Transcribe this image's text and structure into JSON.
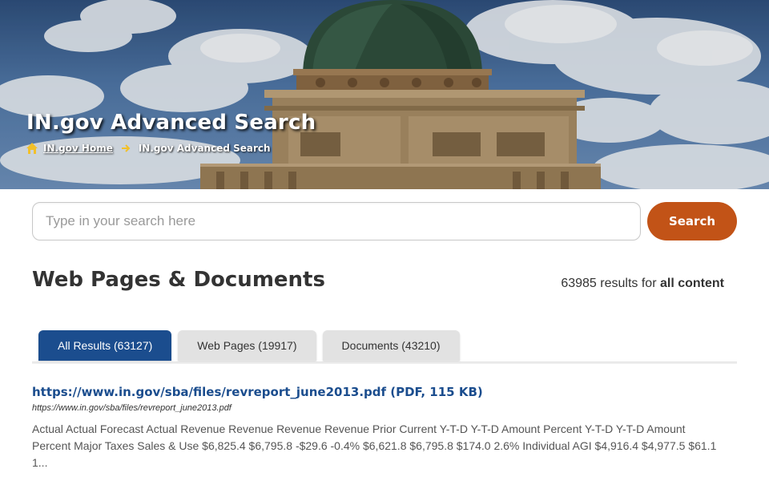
{
  "hero": {
    "title": "IN.gov Advanced Search",
    "breadcrumb": {
      "home_icon": "home-icon",
      "home_label": "IN.gov Home",
      "separator_icon": "arrow-right-icon",
      "current_label": "IN.gov Advanced Search"
    }
  },
  "search": {
    "placeholder": "Type in your search here",
    "value": "",
    "button_label": "Search"
  },
  "results_header": {
    "heading": "Web Pages & Documents",
    "count": "63985",
    "count_text": "results for",
    "scope": "all content"
  },
  "tabs": [
    {
      "label": "All Results (63127)",
      "active": true
    },
    {
      "label": "Web Pages (19917)",
      "active": false
    },
    {
      "label": "Documents (43210)",
      "active": false
    }
  ],
  "results": [
    {
      "title": "https://www.in.gov/sba/files/revreport_june2013.pdf (PDF, 115 KB)",
      "url": "https://www.in.gov/sba/files/revreport_june2013.pdf",
      "snippet": "Actual Actual Forecast Actual Revenue Revenue Revenue Revenue Prior Current Y-T-D Y-T-D Amount Percent Y-T-D Y-T-D Amount Percent Major Taxes Sales & Use $6,825.4 $6,795.8 -$29.6 -0.4% $6,621.8 $6,795.8 $174.0 2.6% Individual AGI $4,916.4 $4,977.5 $61.1 1..."
    }
  ],
  "colors": {
    "accent_blue": "#1b4d8e",
    "search_button": "#c25317",
    "tab_inactive": "#e2e2e2",
    "icon_yellow": "#f2c029"
  }
}
